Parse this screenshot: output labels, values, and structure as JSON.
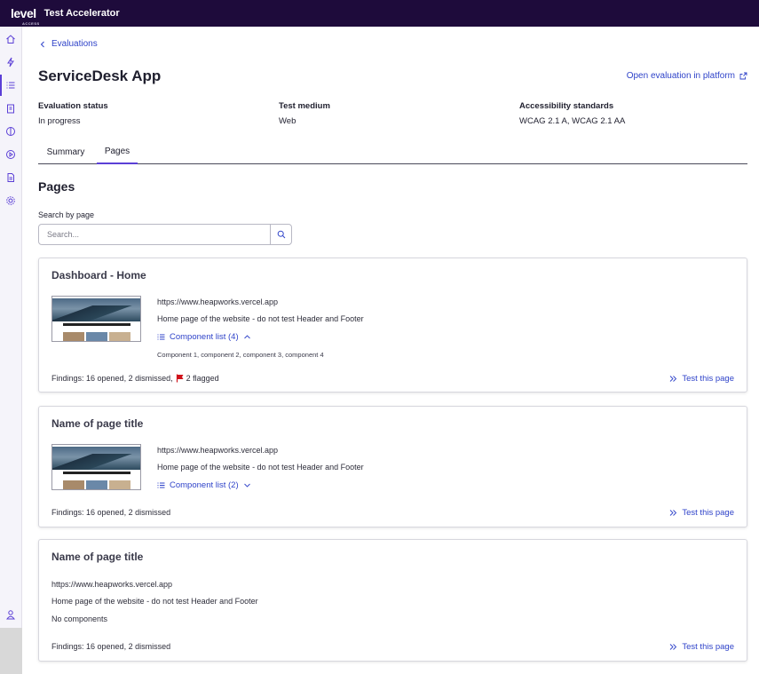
{
  "app": {
    "logo": "level",
    "logo_sub": "ACCESS",
    "title": "Test Accelerator"
  },
  "sidebar": {
    "items": [
      {
        "icon": "home-icon"
      },
      {
        "icon": "bolt-icon"
      },
      {
        "icon": "list-icon",
        "active": true
      },
      {
        "icon": "clipboard-icon"
      },
      {
        "icon": "globe-icon"
      },
      {
        "icon": "play-icon"
      },
      {
        "icon": "document-icon"
      },
      {
        "icon": "gear-icon"
      },
      {
        "icon": "user-icon"
      }
    ]
  },
  "breadcrumb": {
    "label": "Evaluations"
  },
  "header": {
    "title": "ServiceDesk App",
    "open_link": "Open evaluation in platform"
  },
  "meta": {
    "status_label": "Evaluation status",
    "status_value": "In progress",
    "medium_label": "Test medium",
    "medium_value": "Web",
    "standards_label": "Accessibility standards",
    "standards_value": "WCAG 2.1 A, WCAG 2.1 AA"
  },
  "tabs": [
    {
      "label": "Summary",
      "active": false
    },
    {
      "label": "Pages",
      "active": true
    }
  ],
  "pages_section": {
    "title": "Pages",
    "search_label": "Search by page",
    "search_placeholder": "Search..."
  },
  "cards": [
    {
      "title": "Dashboard - Home",
      "url": "https://www.heapworks.vercel.app",
      "description": "Home page of the website - do not test Header and Footer",
      "components_label": "Component list (4)",
      "expanded": true,
      "components_detail": "Component 1, component 2, component 3, component 4",
      "findings": "Findings: 16 opened, 2 dismissed,",
      "flagged": "2 flagged",
      "test_label": "Test this page"
    },
    {
      "title": "Name of page title",
      "url": "https://www.heapworks.vercel.app",
      "description": "Home page of the website - do not test Header and Footer",
      "components_label": "Component list (2)",
      "expanded": false,
      "findings": "Findings: 16 opened, 2 dismissed",
      "test_label": "Test this page"
    },
    {
      "title": "Name of page title",
      "url": "https://www.heapworks.vercel.app",
      "description": "Home page of the website - do not test Header and Footer",
      "no_components": "No components",
      "findings": "Findings: 16 opened, 2 dismissed",
      "test_label": "Test this page"
    }
  ],
  "colors": {
    "topbar": "#1e0b3b",
    "accent": "#5b3fd6",
    "link": "#2f43c9",
    "flag": "#d0121b"
  }
}
